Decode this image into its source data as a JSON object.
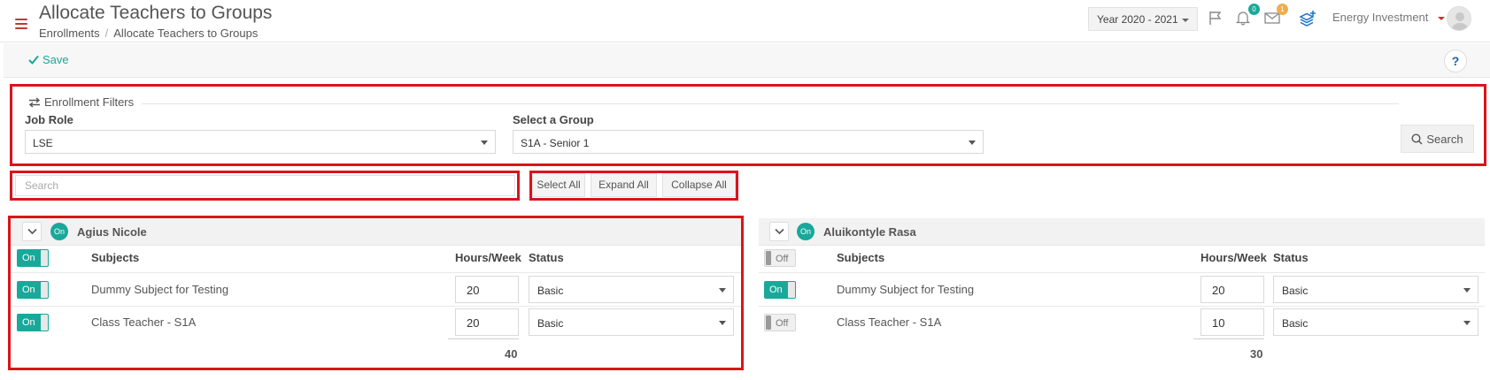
{
  "header": {
    "title": "Allocate Teachers to Groups",
    "breadcrumb": {
      "parent": "Enrollments",
      "separator": "/",
      "current": "Allocate Teachers to Groups"
    },
    "year_select": "Year 2020 - 2021",
    "notifications_count": "0",
    "messages_count": "1",
    "user_name": "Energy Investment",
    "icons": [
      "menu-icon",
      "flag-icon",
      "bell-icon",
      "envelope-icon",
      "layers-add-icon",
      "avatar"
    ]
  },
  "toolbar": {
    "save_label": "Save",
    "help_label": "?"
  },
  "filters": {
    "legend": "Enrollment Filters",
    "job_role_label": "Job Role",
    "job_role_value": "LSE",
    "group_label": "Select a Group",
    "group_value": "S1A - Senior 1",
    "search_label": "Search"
  },
  "actions": {
    "search_placeholder": "Search",
    "select_all": "Select All",
    "expand_all": "Expand All",
    "collapse_all": "Collapse All"
  },
  "columns": {
    "subjects": "Subjects",
    "hours": "Hours/Week",
    "status": "Status"
  },
  "teachers": [
    {
      "name": "Agius Nicole",
      "badge": "On",
      "header_toggle": "On",
      "rows": [
        {
          "toggle": "On",
          "subject": "Dummy Subject for Testing",
          "hours": "20",
          "status": "Basic"
        },
        {
          "toggle": "On",
          "subject": "Class Teacher - S1A",
          "hours": "20",
          "status": "Basic"
        }
      ],
      "total": "40"
    },
    {
      "name": "Aluikontyle Rasa",
      "badge": "On",
      "header_toggle": "Off",
      "rows": [
        {
          "toggle": "On",
          "subject": "Dummy Subject for Testing",
          "hours": "20",
          "status": "Basic"
        },
        {
          "toggle": "Off",
          "subject": "Class Teacher - S1A",
          "hours": "10",
          "status": "Basic"
        }
      ],
      "total": "30"
    }
  ],
  "colors": {
    "accent": "#1aa89a",
    "highlight": "#d9141b",
    "menu": "#c0392b"
  }
}
